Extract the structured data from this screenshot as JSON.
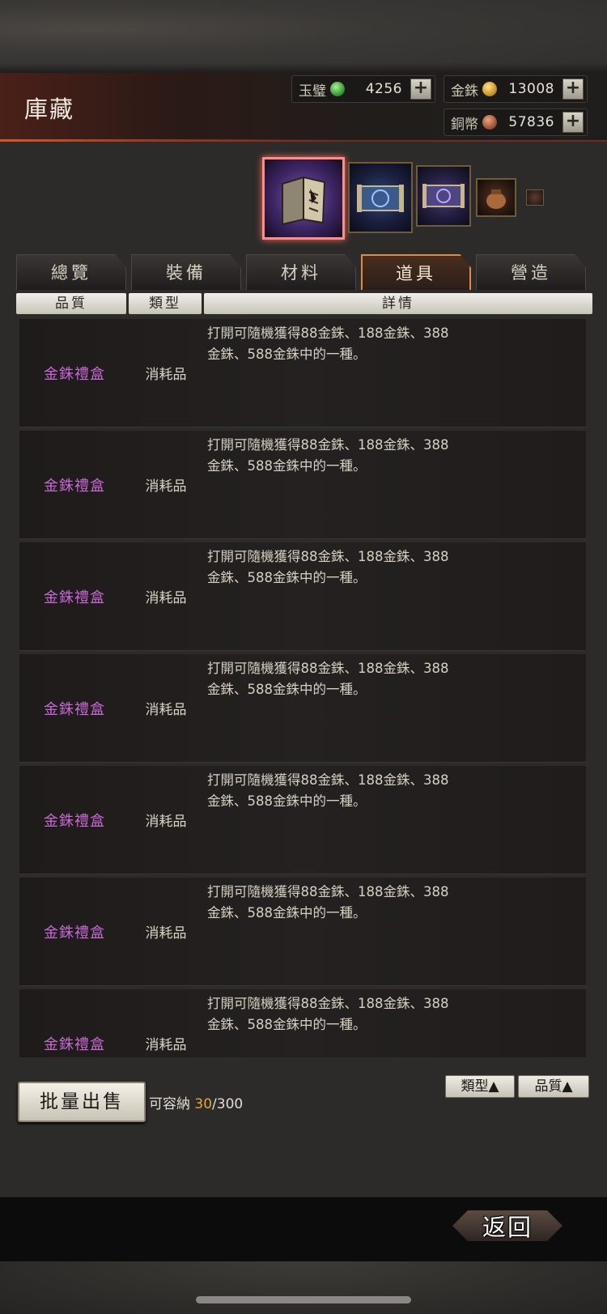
{
  "header": {
    "title": "庫藏",
    "currencies": [
      {
        "name": "jade",
        "label": "玉璧",
        "value": "4256",
        "icon": "jade-coin-icon"
      },
      {
        "name": "gold",
        "label": "金銖",
        "value": "13008",
        "icon": "gold-coin-icon"
      },
      {
        "name": "copper",
        "label": "銅幣",
        "value": "57836",
        "icon": "copper-coin-icon"
      }
    ]
  },
  "categories": [
    {
      "icon": "item-book-icon",
      "selected": true
    },
    {
      "icon": "scroll-blue-icon",
      "selected": false
    },
    {
      "icon": "scroll-purple-icon",
      "selected": false
    },
    {
      "icon": "pouch-icon",
      "selected": false
    },
    {
      "icon": "small-item-icon",
      "selected": false
    }
  ],
  "tabs": [
    {
      "label": "總覽",
      "active": false
    },
    {
      "label": "裝備",
      "active": false
    },
    {
      "label": "材料",
      "active": false
    },
    {
      "label": "道具",
      "active": true
    },
    {
      "label": "營造",
      "active": false
    }
  ],
  "columns": {
    "quality": "品質",
    "type": "類型",
    "detail": "詳情"
  },
  "items": [
    {
      "name": "金銖禮盒",
      "type": "消耗品",
      "detail": "打開可隨機獲得88金銖、188金銖、388金銖、588金銖中的一種。"
    },
    {
      "name": "金銖禮盒",
      "type": "消耗品",
      "detail": "打開可隨機獲得88金銖、188金銖、388金銖、588金銖中的一種。"
    },
    {
      "name": "金銖禮盒",
      "type": "消耗品",
      "detail": "打開可隨機獲得88金銖、188金銖、388金銖、588金銖中的一種。"
    },
    {
      "name": "金銖禮盒",
      "type": "消耗品",
      "detail": "打開可隨機獲得88金銖、188金銖、388金銖、588金銖中的一種。"
    },
    {
      "name": "金銖禮盒",
      "type": "消耗品",
      "detail": "打開可隨機獲得88金銖、188金銖、388金銖、588金銖中的一種。"
    },
    {
      "name": "金銖禮盒",
      "type": "消耗品",
      "detail": "打開可隨機獲得88金銖、188金銖、388金銖、588金銖中的一種。"
    },
    {
      "name": "金銖禮盒",
      "type": "消耗品",
      "detail": "打開可隨機獲得88金銖、188金銖、388金銖、588金銖中的一種。"
    }
  ],
  "bottom": {
    "sell_label": "批量出售",
    "capacity_label": "可容納",
    "capacity_used": "30",
    "capacity_max": "/300",
    "sort_type": "類型▲",
    "sort_quality": "品質▲"
  },
  "footer": {
    "back_label": "返回"
  },
  "colors": {
    "quality_purple": "#c969d6",
    "capacity_orange": "#e3a53c",
    "active_tab_border": "#e08a4a"
  }
}
